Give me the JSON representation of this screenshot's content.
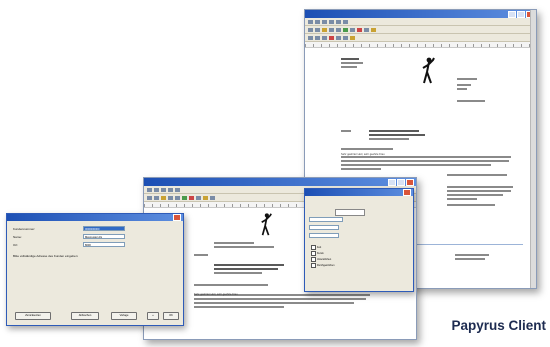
{
  "window_back": {
    "title_text": "",
    "greeting": "Sehr geehrter Herr, sehr geehrte Frau"
  },
  "window_middle": {
    "title_text": "",
    "greeting": "Sehr geehrter Herr, sehr geehrte Frau"
  },
  "format_dialog": {
    "tab_label": "",
    "checkboxes": [
      "Fett",
      "Kursiv",
      "Unterstrichen",
      "Durchgestrichen"
    ]
  },
  "login_dialog": {
    "fields": [
      {
        "label": "Kundennummer:",
        "value": "0000000000",
        "selected": true
      },
      {
        "label": "Name:",
        "value": "Maxmuster AG",
        "selected": false
      },
      {
        "label": "Ort:",
        "value": "8000",
        "selected": false
      }
    ],
    "message": "Bitte vollständige Adresse des Kunden eingeben:",
    "buttons": [
      "Zurücksetzen",
      "Abbrechen",
      "Vorlage",
      "«",
      "OK"
    ]
  },
  "brand": {
    "label": "Papyrus Client",
    "color": "#1d2b50"
  }
}
